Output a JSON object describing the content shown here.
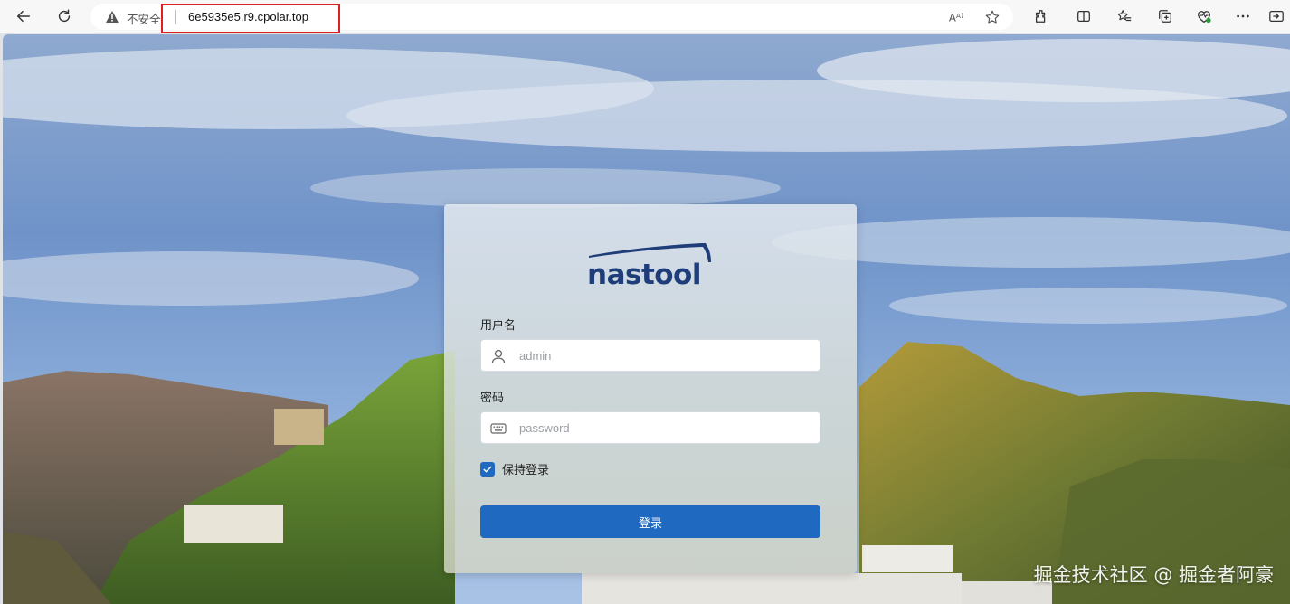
{
  "browser": {
    "security_label": "不安全",
    "url": "6e5935e5.r9.cpolar.top",
    "icons": [
      "back-arrow-icon",
      "reload-icon",
      "warning-icon",
      "read-aloud-icon",
      "favorite-star-icon",
      "extensions-icon",
      "split-screen-icon",
      "favorites-icon",
      "collections-icon",
      "browser-essentials-icon",
      "more-icon",
      "sidebar-icon"
    ]
  },
  "login": {
    "logo_text": "nastool",
    "username_label": "用户名",
    "username_placeholder": "admin",
    "password_label": "密码",
    "password_placeholder": "password",
    "remember_label": "保持登录",
    "remember_checked": true,
    "submit_label": "登录"
  },
  "watermark": "掘金技术社区 @ 掘金者阿豪",
  "colors": {
    "brand": "#1f3d78",
    "primary_button": "#1f6ac0",
    "url_highlight": "#e02020"
  }
}
